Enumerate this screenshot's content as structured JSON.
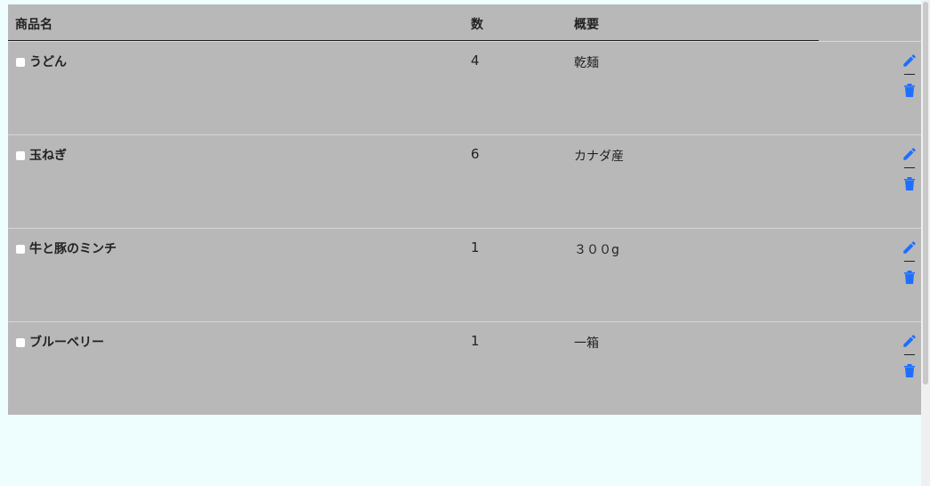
{
  "table": {
    "headers": {
      "name": "商品名",
      "qty": "数",
      "desc": "概要"
    },
    "rows": [
      {
        "name": "うどん",
        "qty": "4",
        "desc": "乾麺"
      },
      {
        "name": "玉ねぎ",
        "qty": "6",
        "desc": "カナダ産"
      },
      {
        "name": "牛と豚のミンチ",
        "qty": "1",
        "desc": "３００g"
      },
      {
        "name": "ブルーベリー",
        "qty": "1",
        "desc": "一箱"
      }
    ],
    "actions": {
      "separator": "|"
    }
  },
  "colors": {
    "table_bg": "#b8b8b8",
    "page_bg": "#eefeff",
    "icon_blue": "#1e6fff"
  }
}
